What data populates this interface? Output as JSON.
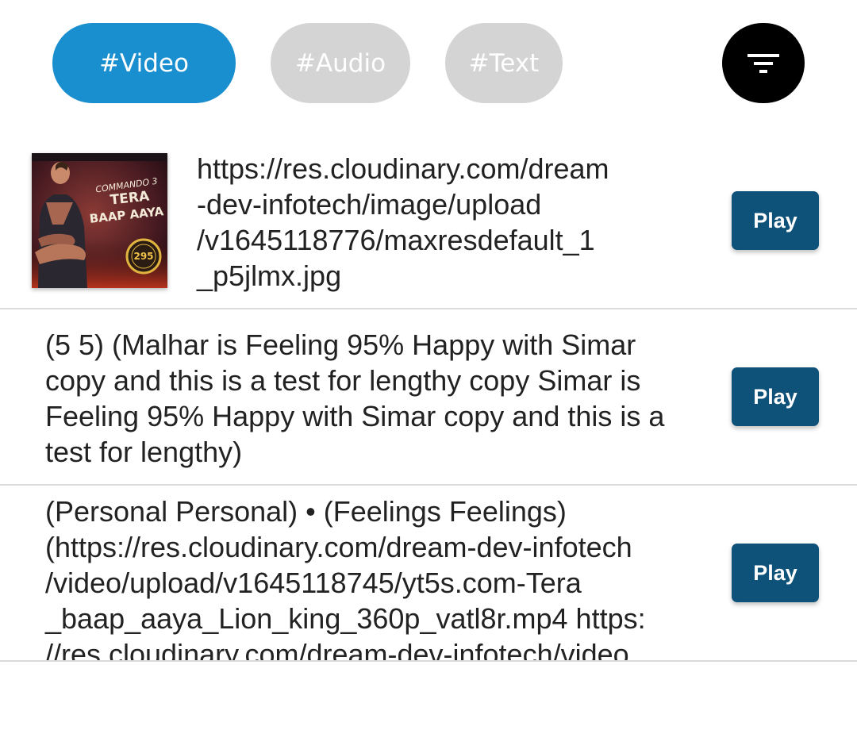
{
  "filters": {
    "chips": [
      {
        "label": "#Video",
        "active": true
      },
      {
        "label": "#Audio",
        "active": false
      },
      {
        "label": "#Text",
        "active": false
      }
    ],
    "filter_icon": "filter-list-icon"
  },
  "items": [
    {
      "thumbnail": {
        "title_lines": [
          "COMMANDO 3",
          "TERA",
          "BAAP AAYA"
        ],
        "badge": "295"
      },
      "text": "https://res.cloudinary.com/dream\n-dev-infotech/image/upload\n/v1645118776/maxresdefault_1\n_p5jlmx.jpg",
      "play_label": "Play"
    },
    {
      "text": "(5 5) (Malhar is Feeling 95% Happy with Simar\ncopy and this is a test for lengthy copy Simar is\nFeeling 95% Happy with Simar copy and this is a\ntest for lengthy)",
      "play_label": "Play"
    },
    {
      "text": "(Personal Personal) • (Feelings Feelings)\n(https://res.cloudinary.com/dream-dev-infotech\n/video/upload/v1645118745/yt5s.com-Tera\n_baap_aaya_Lion_king_360p_vatl8r.mp4 https:\n//res.cloudinary.com/dream-dev-infotech/video",
      "play_label": "Play"
    }
  ],
  "colors": {
    "active_chip": "#1a8fcf",
    "inactive_chip": "#d4d4d4",
    "play_button": "#0e5179"
  }
}
